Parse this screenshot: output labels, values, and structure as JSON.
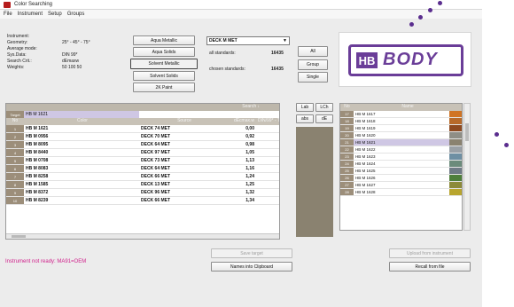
{
  "window": {
    "title": "Color Searching"
  },
  "menu": [
    "File",
    "Instrument",
    "Setup",
    "Groups"
  ],
  "info": {
    "labels": [
      "Instrument:",
      "Geometry:",
      "Average mode:",
      "Sys.Data:",
      "Search Crit.:",
      "Weights:"
    ],
    "values": [
      "",
      "25° - 45° - 75°",
      "",
      "DIN 99*",
      "dEmaxw",
      "50  100  50"
    ]
  },
  "buttons_left": [
    "Aqua Metallic",
    "Aqua Solids",
    "Solvent Metallic",
    "Solvent Solids",
    "2K Paint"
  ],
  "standard": {
    "selected": "DECK M MET",
    "all_label": "all standards:",
    "all_count": "16435",
    "chosen_label": "chosen standards:",
    "chosen_count": "16435"
  },
  "mode_buttons": [
    "All",
    "Group",
    "Single"
  ],
  "logo": {
    "left": "HB",
    "right": "BODY"
  },
  "table": {
    "headers": [
      "No",
      "Color",
      "Source",
      "dEcmax.w",
      "DIN/99* - Ti"
    ],
    "search_label": "Search ↓",
    "target_label": "Target",
    "target_value": "HB M 1621",
    "rows": [
      {
        "no": "1",
        "color": "HB M 1621",
        "source": "DECK 74 MET",
        "de": "0,00"
      },
      {
        "no": "2",
        "color": "HB M 0956",
        "source": "DECK 70 MET",
        "de": "0,92"
      },
      {
        "no": "3",
        "color": "HB M 8095",
        "source": "DECK 64 MET",
        "de": "0,98"
      },
      {
        "no": "4",
        "color": "HB M 8440",
        "source": "DECK 97 MET",
        "de": "1,05"
      },
      {
        "no": "5",
        "color": "HB M 0708",
        "source": "DECK 73 MET",
        "de": "1,13"
      },
      {
        "no": "6",
        "color": "HB M 8083",
        "source": "DECK 64 MET",
        "de": "1,16"
      },
      {
        "no": "7",
        "color": "HB M 8258",
        "source": "DECK 66 MET",
        "de": "1,24"
      },
      {
        "no": "8",
        "color": "HB M 1585",
        "source": "DECK 13 MET",
        "de": "1,25"
      },
      {
        "no": "9",
        "color": "HB M 8372",
        "source": "DECK 96 MET",
        "de": "1,32"
      },
      {
        "no": "10",
        "color": "HB M 8239",
        "source": "DECK 66 MET",
        "de": "1,34"
      }
    ]
  },
  "tabs": {
    "lab": "Lab",
    "lch": "LCh",
    "abs": "abs",
    "de": "dE"
  },
  "list": {
    "headers": [
      "No",
      "Name"
    ],
    "rows": [
      {
        "no": "17",
        "name": "HB M 1617",
        "color": "#d07424"
      },
      {
        "no": "18",
        "name": "HB M 1618",
        "color": "#b76a2a"
      },
      {
        "no": "19",
        "name": "HB M 1619",
        "color": "#8e4a20"
      },
      {
        "no": "20",
        "name": "HB M 1620",
        "color": "#8f8e86"
      },
      {
        "no": "21",
        "name": "HB M 1621",
        "color": "#8a8270",
        "selected": true
      },
      {
        "no": "22",
        "name": "HB M 1622",
        "color": "#9aa0a6"
      },
      {
        "no": "23",
        "name": "HB M 1623",
        "color": "#6e8fa3"
      },
      {
        "no": "24",
        "name": "HB M 1624",
        "color": "#6b8b7b"
      },
      {
        "no": "25",
        "name": "HB M 1625",
        "color": "#6f7b86"
      },
      {
        "no": "26",
        "name": "HB M 1626",
        "color": "#4e7f3b"
      },
      {
        "no": "27",
        "name": "HB M 1627",
        "color": "#8c8a3a"
      },
      {
        "no": "28",
        "name": "HB M 1628",
        "color": "#b8a52e"
      }
    ]
  },
  "status": {
    "text": "Instrument not ready:  MA91=OEM",
    "color": "#d01f8b"
  },
  "bottom_buttons": {
    "save_target": "Save target",
    "names_clipboard": "Names into Clipboard",
    "upload": "Upload from instrument",
    "recall": "Recall from file"
  },
  "colors": {
    "accent_purple": "#6a3d98",
    "selection": "#cfc7e4",
    "row_num": "#9c8e7a"
  }
}
